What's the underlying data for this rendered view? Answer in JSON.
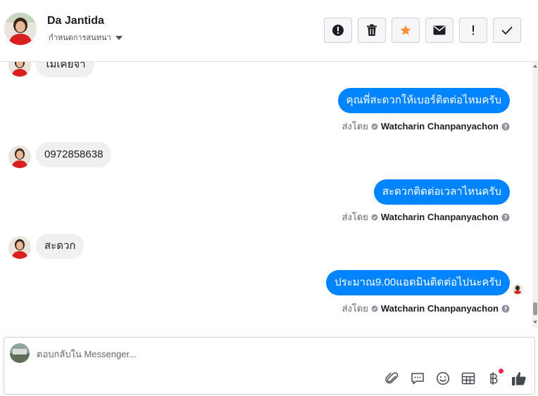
{
  "header": {
    "contact_name": "Da Jantida",
    "assign_label": "กำหนดการสนทนา",
    "actions": [
      {
        "icon": "alert-circle-icon",
        "name": "spam-button"
      },
      {
        "icon": "trash-icon",
        "name": "delete-button"
      },
      {
        "icon": "star-icon",
        "name": "star-button"
      },
      {
        "icon": "envelope-icon",
        "name": "mark-unread-button"
      },
      {
        "icon": "exclamation-icon",
        "name": "follow-up-button"
      },
      {
        "icon": "check-icon",
        "name": "done-button"
      }
    ]
  },
  "messages": {
    "m0": "ไม่เคยจ้า",
    "m1": "คุณพี่สะดวกให้เบอร์ติดต่อไหมครับ",
    "m2": "0972858638",
    "m3": "สะดวกติดต่อเวลาไหนครับ",
    "m4": "สะดวก",
    "m5": "ประมาณ9.00แอดมินติดต่อไปนะครับ",
    "sent_by_label": "ส่งโดย",
    "agent_name": "Watcharin Chanpanyachon"
  },
  "composer": {
    "placeholder": "ตอบกลับใน Messenger...",
    "tools": [
      "paperclip-icon",
      "chat-bubble-icon",
      "smiley-icon",
      "table-icon",
      "baht-icon",
      "thumbs-up-icon"
    ],
    "notification_dot_color": "#f02849"
  },
  "colors": {
    "outgoing_bubble": "#0084ff",
    "incoming_bubble": "#f0f0f0",
    "star": "#f7923a"
  }
}
